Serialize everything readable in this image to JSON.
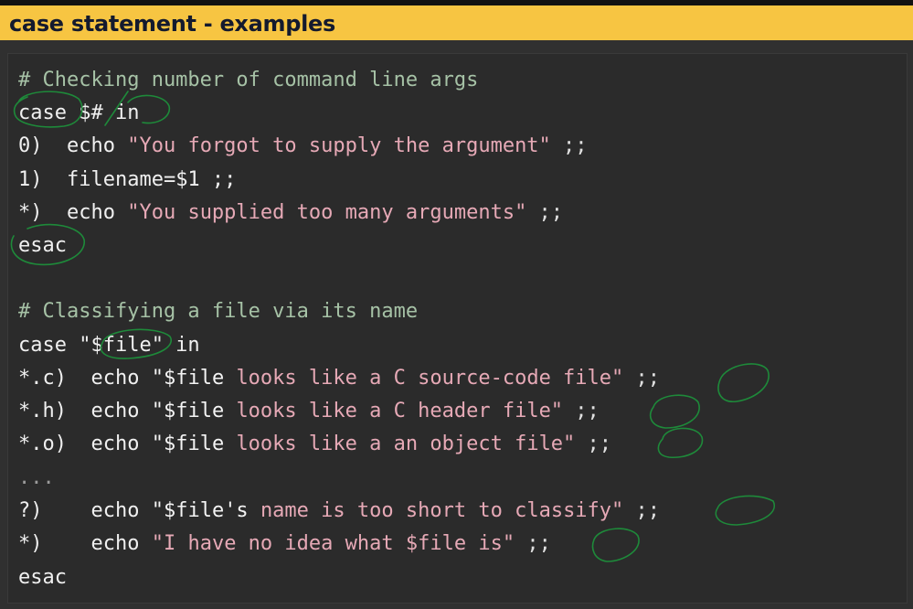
{
  "header": {
    "title": "case statement - examples"
  },
  "code": {
    "lines": [
      {
        "segments": [
          {
            "t": "# Checking number of command line args",
            "c": "cm"
          }
        ]
      },
      {
        "segments": [
          {
            "t": "case $# in",
            "c": "kw"
          }
        ]
      },
      {
        "segments": [
          {
            "t": "0)  ",
            "c": "num"
          },
          {
            "t": "echo ",
            "c": "kw"
          },
          {
            "t": "\"You forgot to supply the argument\"",
            "c": "st"
          },
          {
            "t": " ;;",
            "c": "sy"
          }
        ]
      },
      {
        "segments": [
          {
            "t": "1)  ",
            "c": "num"
          },
          {
            "t": "filename=$1 ;;",
            "c": "kw"
          }
        ]
      },
      {
        "segments": [
          {
            "t": "*)  ",
            "c": "num"
          },
          {
            "t": "echo ",
            "c": "kw"
          },
          {
            "t": "\"You supplied too many arguments\"",
            "c": "st"
          },
          {
            "t": " ;;",
            "c": "sy"
          }
        ]
      },
      {
        "segments": [
          {
            "t": "esac",
            "c": "kw"
          }
        ]
      },
      {
        "segments": [
          {
            "t": "",
            "c": "kw"
          }
        ]
      },
      {
        "segments": [
          {
            "t": "# Classifying a file via its name",
            "c": "cm"
          }
        ]
      },
      {
        "segments": [
          {
            "t": "case \"$file\" in",
            "c": "kw"
          }
        ]
      },
      {
        "segments": [
          {
            "t": "*.c)  ",
            "c": "num"
          },
          {
            "t": "echo ",
            "c": "kw"
          },
          {
            "t": "\"$file ",
            "c": "var"
          },
          {
            "t": "looks like a C source-code file\"",
            "c": "st"
          },
          {
            "t": " ;;",
            "c": "sy"
          }
        ]
      },
      {
        "segments": [
          {
            "t": "*.h)  ",
            "c": "num"
          },
          {
            "t": "echo ",
            "c": "kw"
          },
          {
            "t": "\"$file ",
            "c": "var"
          },
          {
            "t": "looks like a C header file\"",
            "c": "st"
          },
          {
            "t": " ;;",
            "c": "sy"
          }
        ]
      },
      {
        "segments": [
          {
            "t": "*.o)  ",
            "c": "num"
          },
          {
            "t": "echo ",
            "c": "kw"
          },
          {
            "t": "\"$file ",
            "c": "var"
          },
          {
            "t": "looks like a an object file\"",
            "c": "st"
          },
          {
            "t": " ;;",
            "c": "sy"
          }
        ]
      },
      {
        "segments": [
          {
            "t": "...",
            "c": "dim"
          }
        ]
      },
      {
        "segments": [
          {
            "t": "?)    ",
            "c": "num"
          },
          {
            "t": "echo ",
            "c": "kw"
          },
          {
            "t": "\"$file's ",
            "c": "var"
          },
          {
            "t": "name is too short to classify\"",
            "c": "st"
          },
          {
            "t": " ;;",
            "c": "sy"
          }
        ]
      },
      {
        "segments": [
          {
            "t": "*)    ",
            "c": "num"
          },
          {
            "t": "echo ",
            "c": "kw"
          },
          {
            "t": "\"I have no idea what $file is\"",
            "c": "st"
          },
          {
            "t": " ;;",
            "c": "sy"
          }
        ]
      },
      {
        "segments": [
          {
            "t": "esac",
            "c": "kw"
          }
        ]
      }
    ]
  },
  "colors": {
    "header_bg": "#f7c542",
    "header_text": "#141a2e",
    "editor_bg": "#2b2b2b",
    "comment": "#a6c2a6",
    "string": "#e6a9b6",
    "annotation_ink": "#1e8a3a"
  }
}
